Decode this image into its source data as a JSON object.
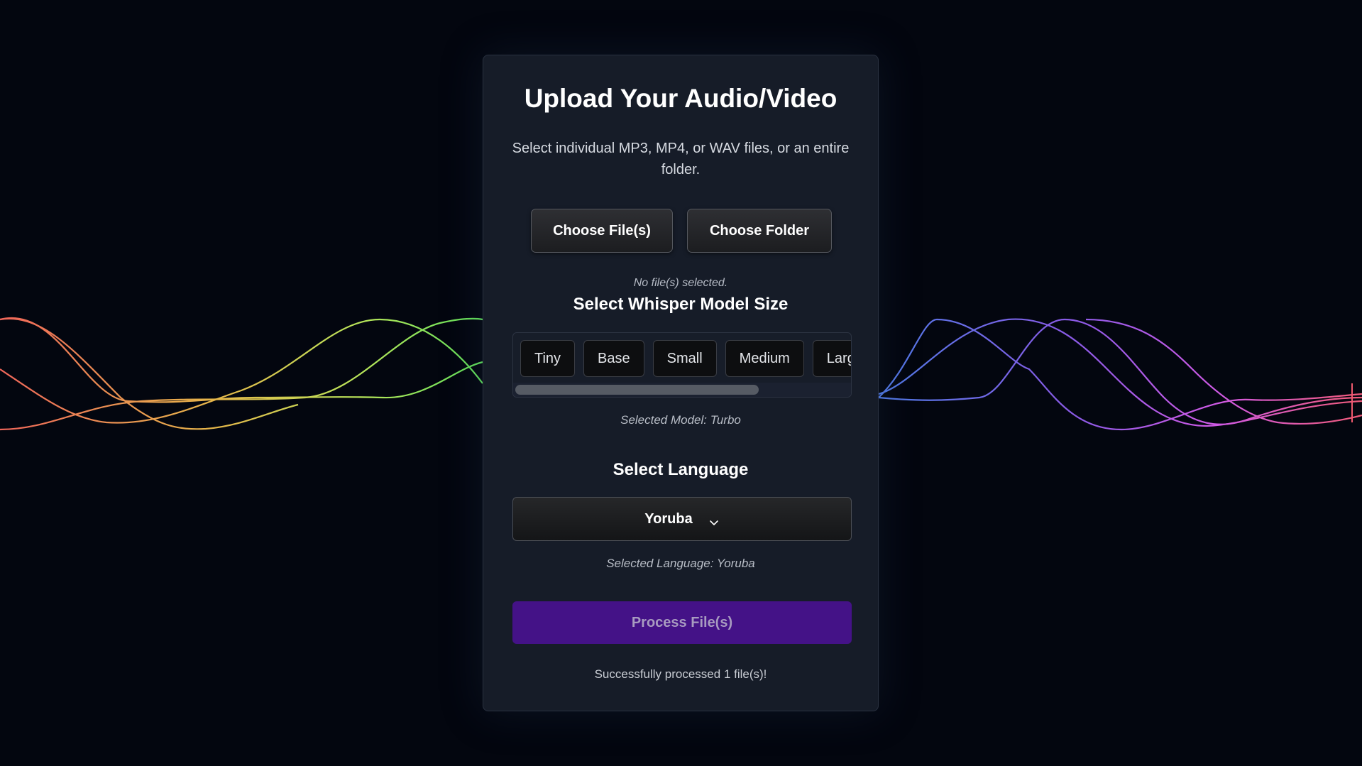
{
  "upload": {
    "title": "Upload Your Audio/Video",
    "subtitle": "Select individual MP3, MP4, or WAV files, or an entire folder.",
    "choose_files_label": "Choose File(s)",
    "choose_folder_label": "Choose Folder",
    "file_status": "No file(s) selected."
  },
  "model": {
    "heading": "Select Whisper Model Size",
    "options": [
      "Tiny",
      "Base",
      "Small",
      "Medium",
      "Large"
    ],
    "selected_text": "Selected Model: Turbo"
  },
  "language": {
    "heading": "Select Language",
    "selected_value": "Yoruba",
    "selected_text": "Selected Language: Yoruba"
  },
  "process": {
    "button_label": "Process File(s)",
    "result_text": "Successfully processed 1 file(s)!"
  },
  "icons": {
    "dropdown": "chevron-down-icon"
  },
  "colors": {
    "page_background": "#03060f",
    "card_background": "#161c28",
    "process_button": "#441287",
    "wave_colors": [
      "#f0665a",
      "#e6b84a",
      "#c8e65a",
      "#6ee05a",
      "#5a78e6",
      "#8a5ae6",
      "#d05ae6",
      "#f05a8c"
    ]
  }
}
